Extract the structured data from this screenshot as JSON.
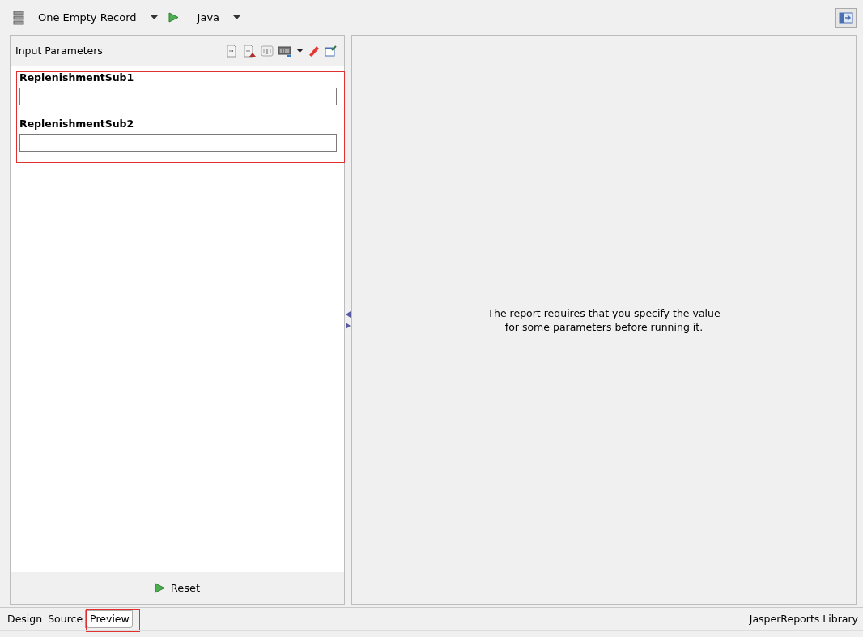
{
  "toolbar": {
    "data_adapter": "One Empty Record",
    "language": "Java"
  },
  "parameters_panel": {
    "title": "Input Parameters",
    "fields": [
      {
        "label": "ReplenishmentSub1",
        "focused": true
      },
      {
        "label": "ReplenishmentSub2",
        "focused": false
      }
    ],
    "reset_button": "Reset"
  },
  "preview": {
    "message_lines": [
      "The report requires that you specify the value",
      "for some parameters before running it."
    ]
  },
  "tabs": [
    {
      "label": "Design",
      "selected": false,
      "highlighted": false
    },
    {
      "label": "Source",
      "selected": false,
      "highlighted": false
    },
    {
      "label": "Preview",
      "selected": true,
      "highlighted": true
    }
  ],
  "status": "JasperReports Library"
}
